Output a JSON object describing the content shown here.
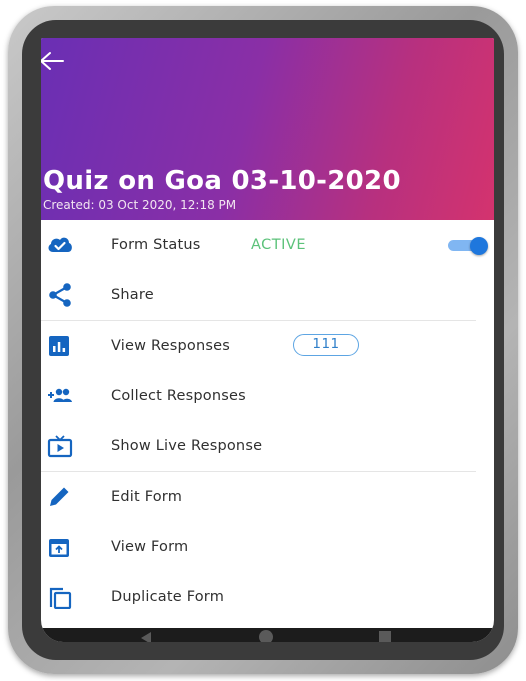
{
  "header": {
    "title": "Quiz on Goa 03-10-2020",
    "created": "Created: 03 Oct 2020, 12:18 PM"
  },
  "menu": {
    "form_status": {
      "label": "Form Status",
      "status": "ACTIVE",
      "toggle_on": true
    },
    "share": {
      "label": "Share"
    },
    "view_responses": {
      "label": "View Responses",
      "count": "111"
    },
    "collect_responses": {
      "label": "Collect Responses"
    },
    "show_live_response": {
      "label": "Show Live Response"
    },
    "edit_form": {
      "label": "Edit Form"
    },
    "view_form": {
      "label": "View Form"
    },
    "duplicate_form": {
      "label": "Duplicate Form"
    }
  },
  "colors": {
    "header_gradient_start": "#6a2fb4",
    "header_gradient_end": "#d4336e",
    "icon_blue": "#1565c0",
    "status_green": "#5cc27a",
    "toggle_blue": "#1e77dd"
  },
  "icons": [
    "back-arrow-icon",
    "cloud-check-icon",
    "share-icon",
    "bar-chart-icon",
    "add-group-icon",
    "live-tv-icon",
    "pencil-icon",
    "open-in-box-icon",
    "duplicate-icon"
  ]
}
